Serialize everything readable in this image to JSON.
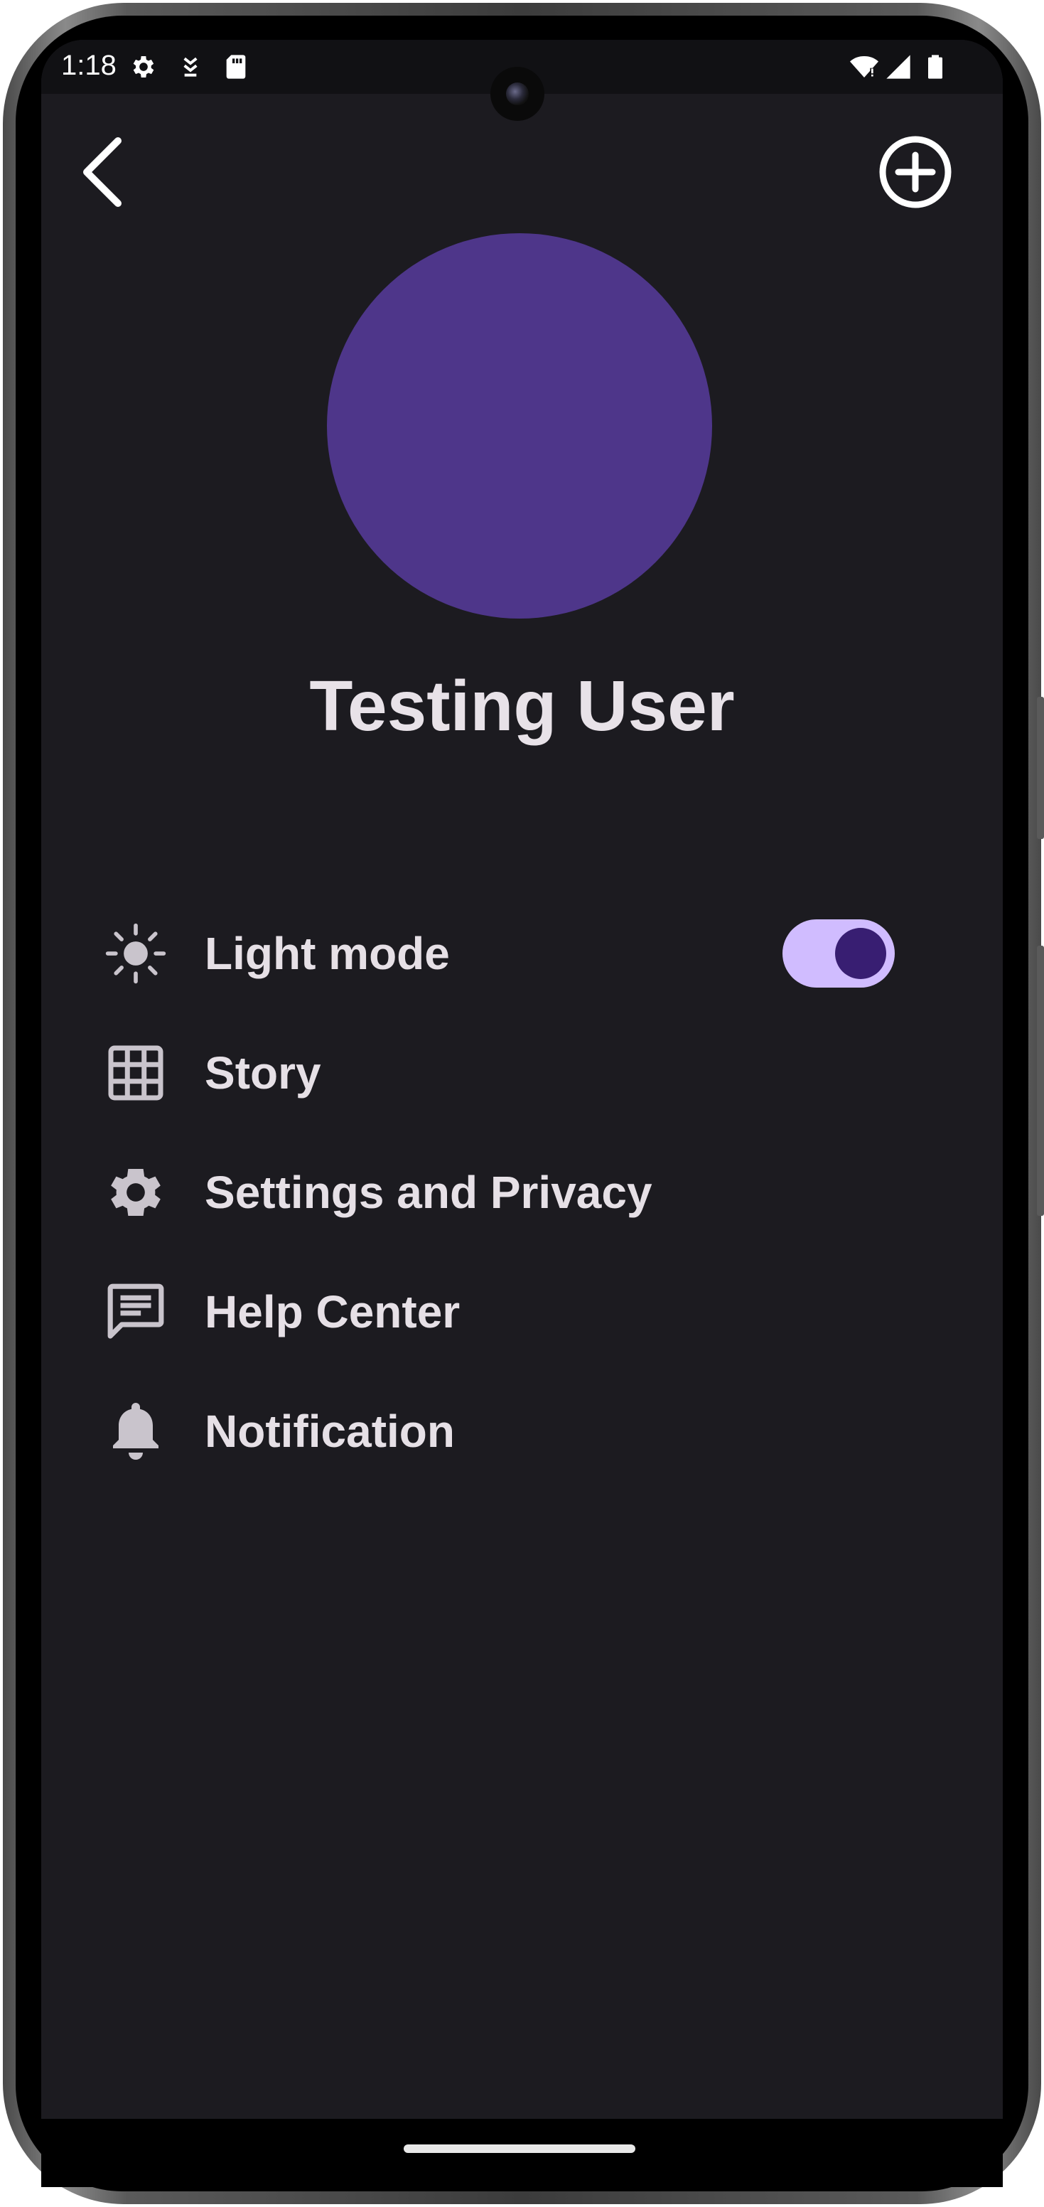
{
  "status_bar": {
    "time": "1:18",
    "icons_left": [
      "gear-icon",
      "download-icon",
      "sd-card-icon"
    ],
    "icons_right": [
      "wifi-icon",
      "signal-icon",
      "battery-icon"
    ]
  },
  "header": {
    "back_icon": "chevron-left-icon",
    "add_icon": "plus-circle-icon"
  },
  "profile": {
    "name": "Testing User",
    "avatar_color": "#4e368a"
  },
  "menu": {
    "items": [
      {
        "label": "Light mode",
        "icon": "sun-icon"
      },
      {
        "label": "Story",
        "icon": "grid-icon"
      },
      {
        "label": "Settings and Privacy",
        "icon": "gear-icon"
      },
      {
        "label": "Help Center",
        "icon": "chat-icon"
      },
      {
        "label": "Notification",
        "icon": "bell-icon"
      }
    ],
    "light_mode_toggle": {
      "on": true,
      "track_color": "#d0bcff",
      "knob_color": "#381e72"
    }
  },
  "colors": {
    "background": "#1c1b20",
    "text": "#e6e0e6",
    "icon": "#c9c4cc"
  }
}
